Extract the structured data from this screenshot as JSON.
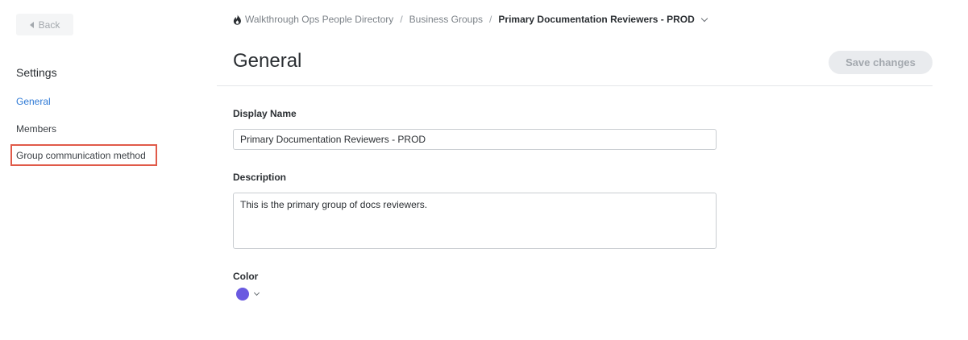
{
  "sidebar": {
    "back_label": "Back",
    "heading": "Settings",
    "items": [
      {
        "label": "General",
        "active": true
      },
      {
        "label": "Members",
        "active": false
      },
      {
        "label": "Group communication method",
        "active": false
      }
    ]
  },
  "breadcrumb": {
    "items": [
      "Walkthrough Ops People Directory",
      "Business Groups"
    ],
    "current": "Primary Documentation Reviewers - PROD",
    "separator": "/"
  },
  "header": {
    "title": "General",
    "save_label": "Save changes"
  },
  "form": {
    "display_name": {
      "label": "Display Name",
      "value": "Primary Documentation Reviewers - PROD"
    },
    "description": {
      "label": "Description",
      "value": "This is the primary group of docs reviewers."
    },
    "color": {
      "label": "Color",
      "value": "#6a5ae0"
    }
  },
  "colors": {
    "accent": "#2f7ad6",
    "highlight": "#e05a49",
    "brand_flame": "#2b2f33"
  },
  "icons": {
    "back": "caret-left-icon",
    "brand": "flame-icon",
    "breadcrumb_menu": "chevron-down-icon",
    "color_menu": "chevron-down-icon"
  }
}
